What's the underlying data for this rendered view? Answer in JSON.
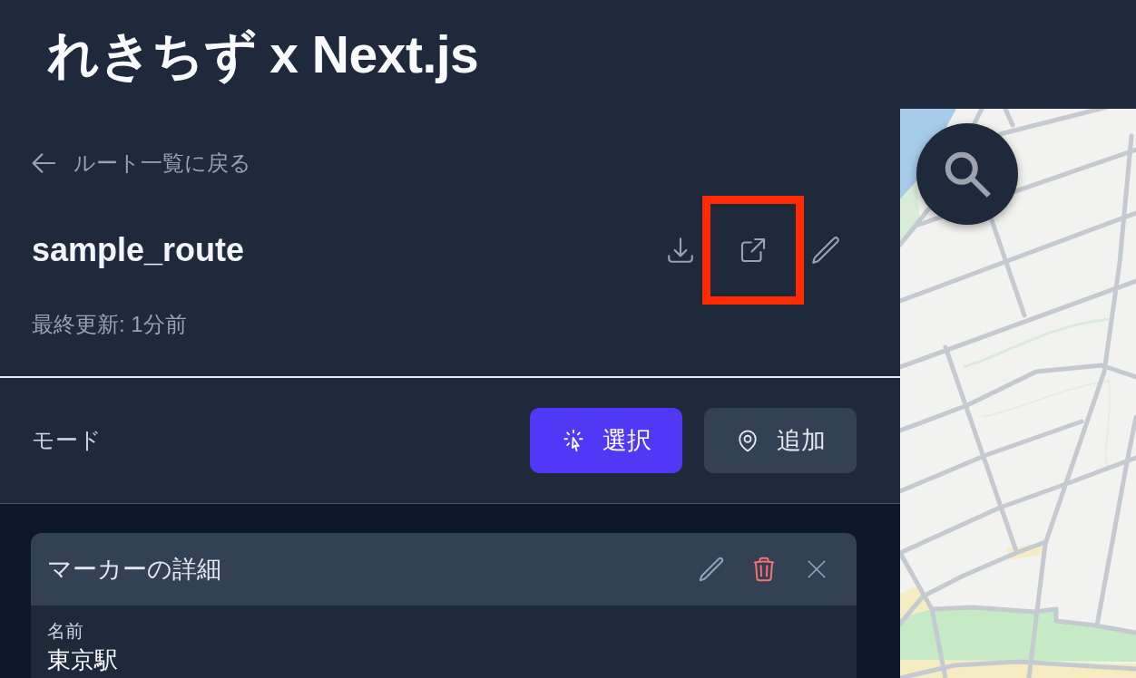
{
  "header": {
    "title": "れきちず x Next.js"
  },
  "route": {
    "back_link": "ルート一覧に戻る",
    "name": "sample_route",
    "updated": "最終更新: 1分前",
    "actions": [
      {
        "kind": "download",
        "highlighted": false
      },
      {
        "kind": "open-external",
        "highlighted": true
      },
      {
        "kind": "edit",
        "highlighted": false
      }
    ]
  },
  "mode": {
    "label": "モード",
    "options": [
      {
        "kind": "select",
        "label": "選択",
        "selected": true
      },
      {
        "kind": "add",
        "label": "追加",
        "selected": false
      }
    ]
  },
  "marker_details": {
    "title": "マーカーの詳細",
    "actions": [
      {
        "kind": "edit"
      },
      {
        "kind": "delete"
      },
      {
        "kind": "close"
      }
    ],
    "fields": [
      {
        "label": "名前",
        "value": "東京駅"
      }
    ]
  }
}
